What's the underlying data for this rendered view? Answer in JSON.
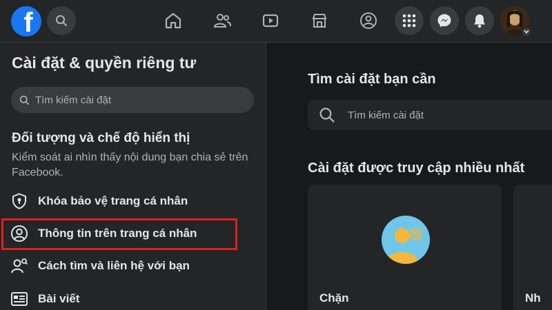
{
  "topbar": {
    "icons": [
      "facebook-logo",
      "search-icon",
      "home-icon",
      "friends-icon",
      "watch-icon",
      "marketplace-icon",
      "groups-icon",
      "menu-grid-icon",
      "messenger-icon",
      "notifications-icon",
      "account-avatar",
      "chevron-down-icon"
    ],
    "logo_letter": "f",
    "brand_color": "#1877f2"
  },
  "sidebar": {
    "title": "Cài đặt & quyền riêng tư",
    "search_placeholder": "Tìm kiếm cài đặt",
    "section_title": "Đối tượng và chế độ hiển thị",
    "section_desc": "Kiểm soát ai nhìn thấy nội dung bạn chia sẻ trên Facebook.",
    "items": [
      {
        "label": "Khóa bảo vệ trang cá nhân",
        "icon": "shield-lock-icon"
      },
      {
        "label": "Thông tin trên trang cá nhân",
        "icon": "profile-icon"
      },
      {
        "label": "Cách tìm và liên hệ với bạn",
        "icon": "find-contact-icon"
      },
      {
        "label": "Bài viết",
        "icon": "posts-icon"
      }
    ],
    "highlight_color": "#e0201f"
  },
  "main": {
    "heading": "Tìm cài đặt bạn cần",
    "search_placeholder": "Tìm kiếm cài đặt",
    "most_accessed_heading": "Cài đặt được truy cập nhiều nhất",
    "cards": [
      {
        "label": "Chặn",
        "icon": "blocking-icon"
      },
      {
        "label": "Nh"
      }
    ]
  }
}
